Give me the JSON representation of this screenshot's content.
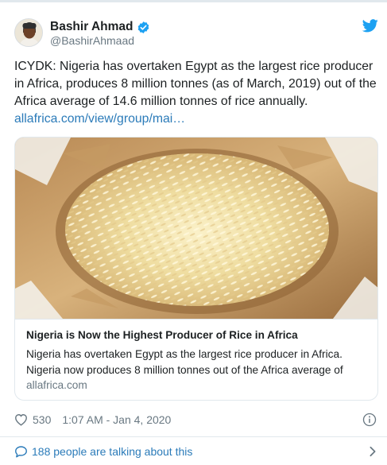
{
  "author": {
    "name": "Bashir Ahmad",
    "handle": "@BashirAhmaad",
    "verified": true
  },
  "tweet": {
    "text": "ICYDK: Nigeria has overtaken Egypt as the largest rice producer in Africa, produces 8 million tonnes (as of March, 2019) out of the Africa average of 14.6 million tonnes of rice annually.",
    "link_text": "allafrica.com/view/group/mai…"
  },
  "card": {
    "image_icon": "rice-in-sack-photo",
    "title": "Nigeria is Now the Highest Producer of Rice in Africa",
    "description": "Nigeria has overtaken Egypt as the largest rice producer in Africa. Nigeria now produces 8 million tonnes out of the Africa average of",
    "domain": "allafrica.com"
  },
  "actions": {
    "like_icon": "heart-icon",
    "like_count": "530",
    "timestamp": "1:07 AM - Jan 4, 2020",
    "info_icon": "info-icon"
  },
  "conversation": {
    "icon": "speech-bubble-icon",
    "text": "188 people are talking about this"
  },
  "colors": {
    "link": "#2b7bb9",
    "verified": "#1da1f2",
    "twitter_bird": "#1da1f2",
    "muted_text": "#697882",
    "border": "#e1e8ed"
  }
}
